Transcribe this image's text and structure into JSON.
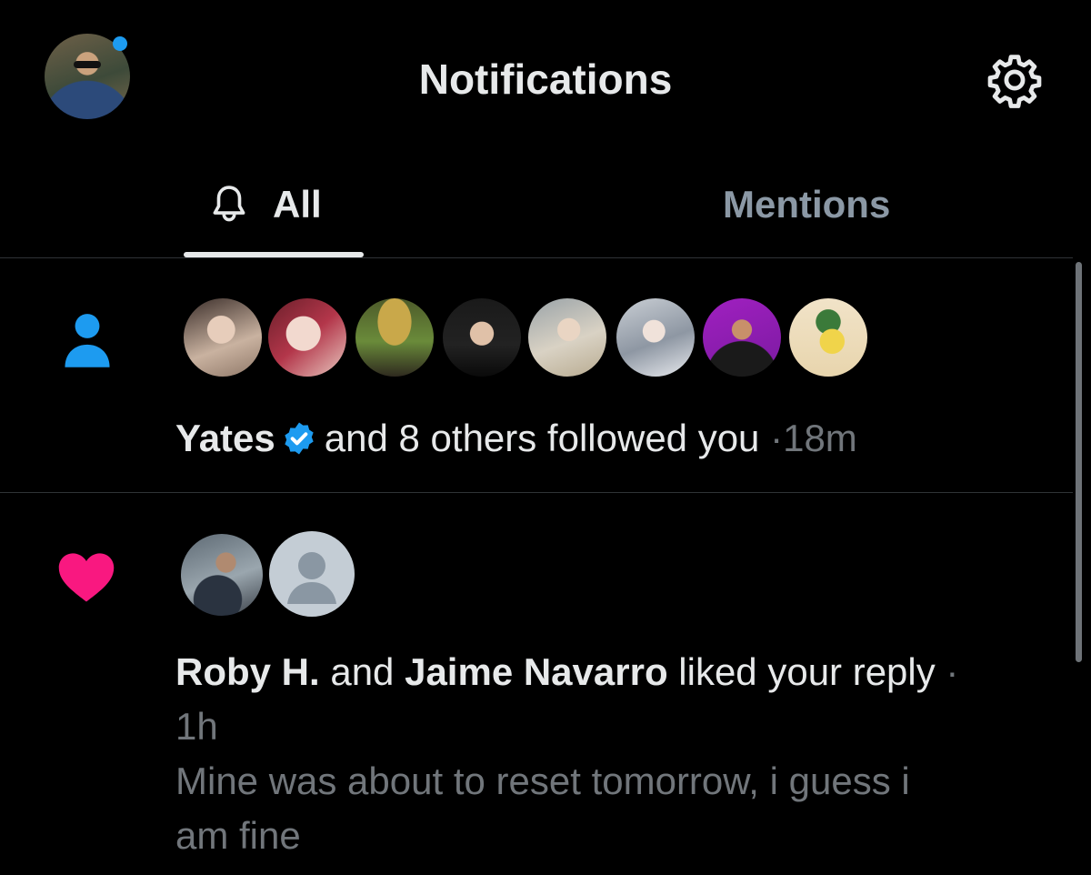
{
  "header": {
    "title": "Notifications",
    "profile_icon": "user-avatar",
    "settings_icon": "gear-icon"
  },
  "tabs": [
    {
      "label": "All",
      "icon": "bell-icon",
      "active": true
    },
    {
      "label": "Mentions",
      "active": false
    }
  ],
  "notifications": [
    {
      "type": "follow",
      "icon": "person-icon",
      "avatars_count": 8,
      "actor": "Yates",
      "verified": true,
      "action": "and 8 others followed you",
      "separator": "·",
      "time": "18m"
    },
    {
      "type": "like",
      "icon": "heart-icon",
      "avatars_count": 2,
      "actor1": "Roby H.",
      "connector": "and",
      "actor2": "Jaime Navarro",
      "action": "liked your reply",
      "separator": "·",
      "time": "1h",
      "reply_line1": "Mine was about to reset tomorrow, i guess i",
      "reply_line2": "am fine"
    }
  ],
  "colors": {
    "background": "#000000",
    "accent_blue": "#1d9bf0",
    "like_pink": "#f91880",
    "muted_text": "#71767b"
  }
}
